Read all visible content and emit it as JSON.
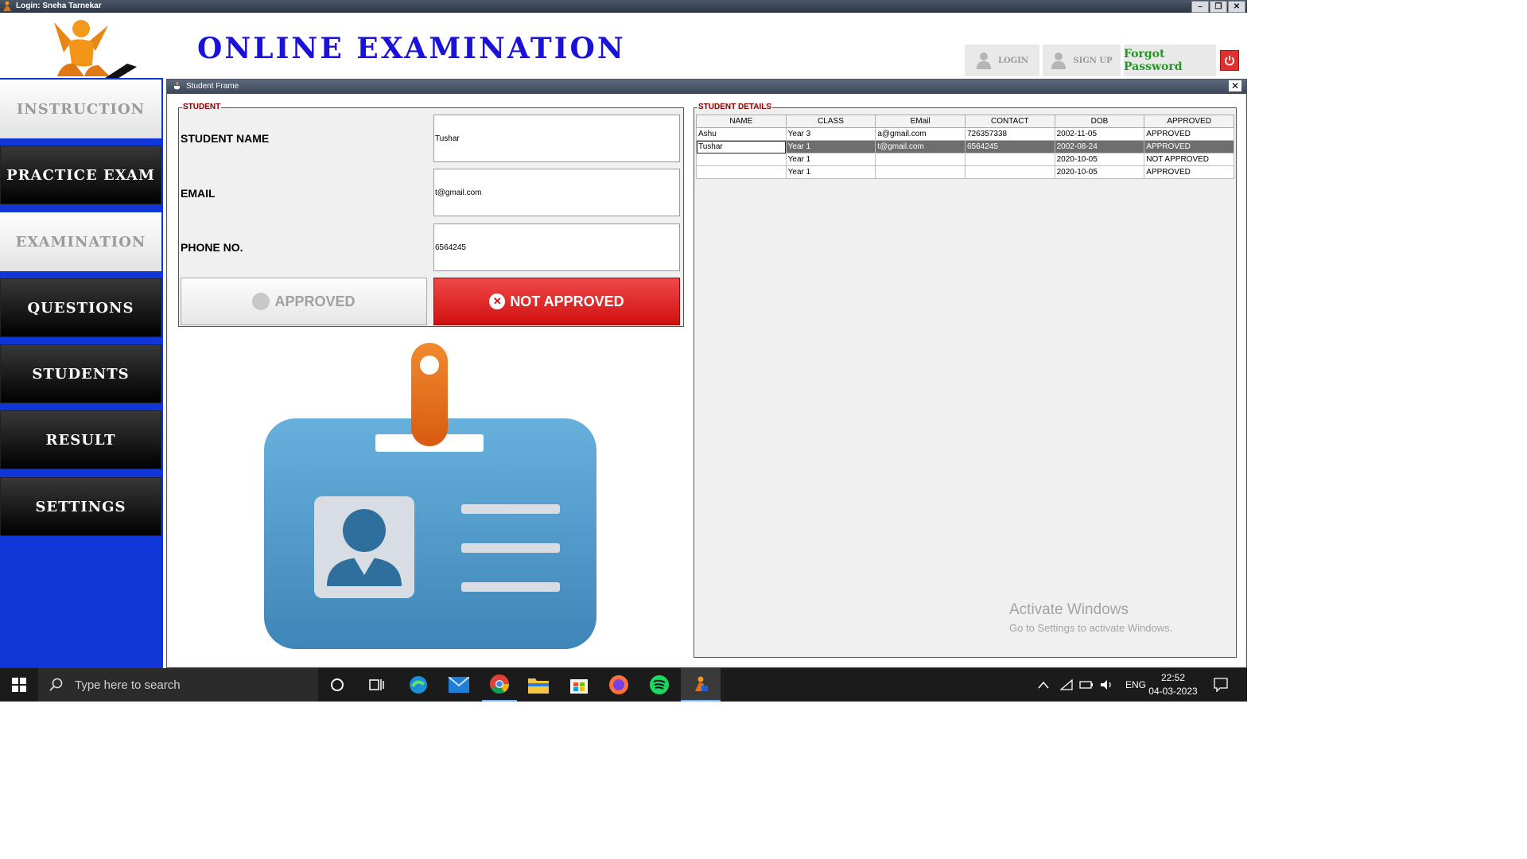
{
  "window": {
    "title": "Login: Sneha Tarnekar",
    "minimize": "–",
    "restore": "❐",
    "close": "✕"
  },
  "header": {
    "app_title": "ONLINE EXAMINATION",
    "login_label": "LOGIN",
    "signup_label": "SIGN UP",
    "forgot_label": "Forgot Password",
    "power_icon": "power-icon"
  },
  "sidebar": {
    "items": [
      {
        "label": "INSTRUCTION",
        "style": "light"
      },
      {
        "label": "PRACTICE EXAM",
        "style": "dark"
      },
      {
        "label": "EXAMINATION",
        "style": "light"
      },
      {
        "label": "QUESTIONS",
        "style": "dark"
      },
      {
        "label": "STUDENTS",
        "style": "dark"
      },
      {
        "label": "RESULT",
        "style": "dark"
      },
      {
        "label": "SETTINGS",
        "style": "dark"
      }
    ],
    "accent": "#1036d8"
  },
  "frame": {
    "title": "Student Frame",
    "close": "✕",
    "student": {
      "group_title": "STUDENT",
      "name_label": "STUDENT NAME",
      "name_value": "Tushar",
      "email_label": "EMAIL",
      "email_value": "t@gmail.com",
      "phone_label": "PHONE NO.",
      "phone_value": "6564245",
      "approved_btn": "APPROVED",
      "not_approved_btn": "NOT APPROVED",
      "not_approved_icon": "✕",
      "not_approved_color": "#d01010"
    },
    "details": {
      "group_title": "STUDENT DETAILS",
      "columns": [
        "NAME",
        "CLASS",
        "EMail",
        "CONTACT",
        "DOB",
        "APPROVED"
      ],
      "rows": [
        [
          "Ashu",
          "Year 3",
          "a@gmail.com",
          "726357338",
          "2002-11-05",
          "APPROVED"
        ],
        [
          "Tushar",
          "Year 1",
          "t@gmail.com",
          "6564245",
          "2002-08-24",
          "APPROVED"
        ],
        [
          "",
          "Year 1",
          "",
          "",
          "2020-10-05",
          "NOT APPROVED"
        ],
        [
          "",
          "Year 1",
          "",
          "",
          "2020-10-05",
          "APPROVED"
        ]
      ]
    }
  },
  "watermark": {
    "line1": "Activate Windows",
    "line2": "Go to Settings to activate Windows."
  },
  "taskbar": {
    "search_placeholder": "Type here to search",
    "language": "ENG",
    "time": "22:52",
    "date": "04-03-2023"
  }
}
